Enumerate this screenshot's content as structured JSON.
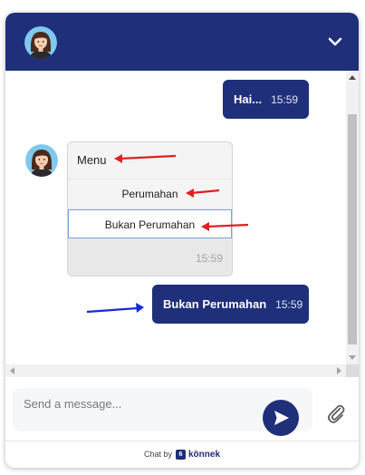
{
  "header": {
    "avatar_icon": "agent-avatar-icon",
    "collapse_icon": "chevron-down-icon",
    "accent_color": "#1f2f7a"
  },
  "messages": [
    {
      "text": "Hai...",
      "time": "15:59"
    },
    {
      "text": "Bukan Perumahan",
      "time": "15:59"
    }
  ],
  "menu": {
    "title": "Menu",
    "options": [
      "Perumahan",
      "Bukan Perumahan"
    ],
    "selected_option": "Bukan Perumahan",
    "time": "15:59"
  },
  "composer": {
    "placeholder": "Send a message...",
    "value": "",
    "send_icon": "send-icon",
    "attach_icon": "paperclip-icon"
  },
  "footer": {
    "prefix": "Chat by",
    "brand": "könnek",
    "brand_mark": "6"
  },
  "annotation_colors": {
    "red_arrows": "#e02020",
    "blue_arrow": "#1a2ad6"
  }
}
